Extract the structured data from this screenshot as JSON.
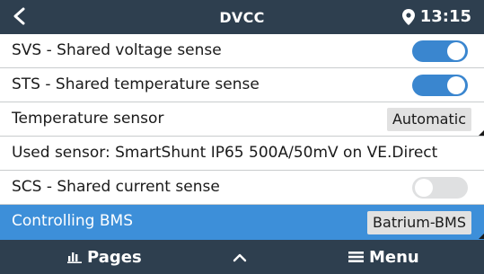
{
  "header": {
    "title": "DVCC",
    "time": "13:15"
  },
  "rows": [
    {
      "label": "SVS - Shared voltage sense",
      "toggle": "on"
    },
    {
      "label": "STS - Shared temperature sense",
      "toggle": "on"
    },
    {
      "label": "Temperature sensor",
      "value": "Automatic"
    },
    {
      "label": "Used sensor: SmartShunt IP65 500A/50mV on VE.Direct"
    },
    {
      "label": "SCS - Shared current sense",
      "toggle": "off"
    },
    {
      "label": "Controlling BMS",
      "value": "Batrium-BMS",
      "selected": true
    }
  ],
  "footer": {
    "pages_label": "Pages",
    "menu_label": "Menu"
  },
  "colors": {
    "header_bg": "#2e3f4f",
    "toggle_on": "#3a86cf",
    "selected_row": "#3d8fd9"
  },
  "icons": [
    "back-arrow-icon",
    "location-pin-icon",
    "bar-chart-icon",
    "chevron-up-icon",
    "hamburger-menu-icon"
  ]
}
